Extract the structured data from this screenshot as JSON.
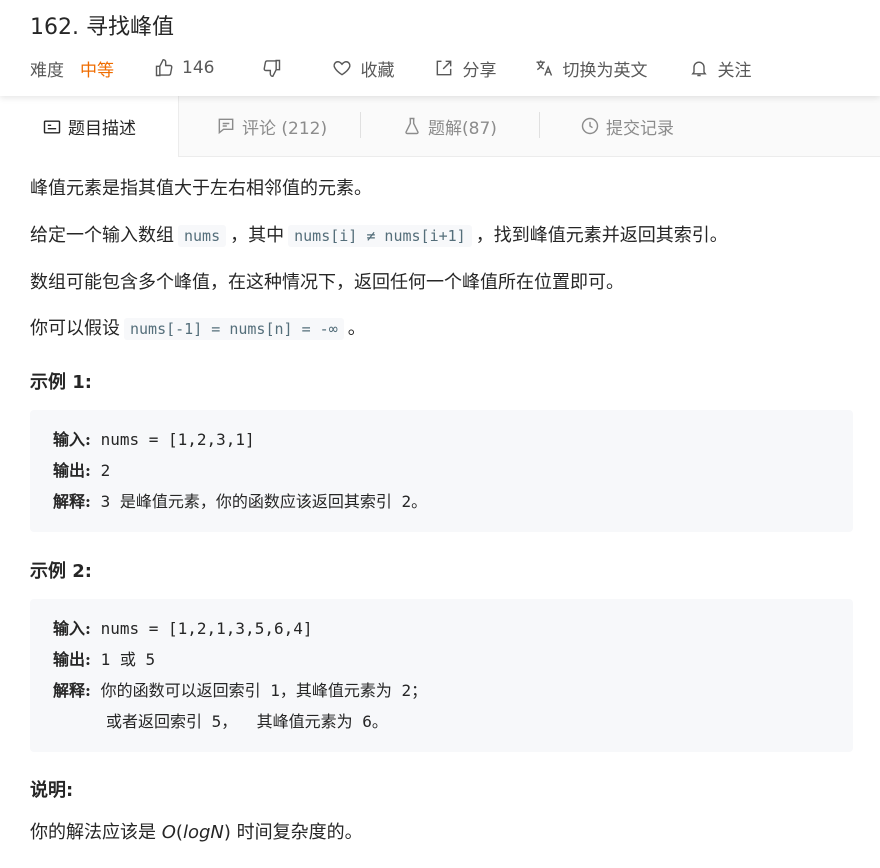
{
  "problem": {
    "title": "162. 寻找峰值",
    "difficulty_label": "难度",
    "difficulty_value": "中等",
    "likes": "146",
    "favorite_label": "收藏",
    "share_label": "分享",
    "switch_lang_label": "切换为英文",
    "follow_label": "关注"
  },
  "tabs": [
    {
      "label": "题目描述"
    },
    {
      "label": "评论 (212)"
    },
    {
      "label": "题解(87)"
    },
    {
      "label": "提交记录"
    }
  ],
  "description": {
    "p1": "峰值元素是指其值大于左右相邻值的元素。",
    "p2_a": "给定一个输入数组",
    "p2_code1": "nums",
    "p2_b": "，其中",
    "p2_code2": "nums[i] ≠ nums[i+1]",
    "p2_c": "，找到峰值元素并返回其索引。",
    "p3": "数组可能包含多个峰值，在这种情况下，返回任何一个峰值所在位置即可。",
    "p4_a": "你可以假设",
    "p4_code": "nums[-1] = nums[n] = -∞",
    "p4_b": "。"
  },
  "example1": {
    "heading": "示例 1:",
    "input_label": "输入:",
    "input_value": "nums = [1,2,3,1]",
    "output_label": "输出:",
    "output_value": "2",
    "explain_label": "解释:",
    "explain_num": "3",
    "explain_text": "是峰值元素，你的函数应该返回其索引",
    "explain_idx": "2。"
  },
  "example2": {
    "heading": "示例 2:",
    "input_label": "输入:",
    "input_value": "nums = [1,2,1,3,5,6,4]",
    "output_label": "输出:",
    "output_a": "1",
    "output_or": "或",
    "output_b": "5",
    "explain_label": "解释:",
    "explain_text1": "你的函数可以返回索引",
    "explain_idx1": "1，",
    "explain_text2": "其峰值元素为",
    "explain_val1": "2；",
    "explain2_text1": "或者返回索引",
    "explain2_idx": "5，",
    "explain2_text2": "其峰值元素为",
    "explain2_val": "6。"
  },
  "note": {
    "heading": "说明:",
    "text_a": "你的解法应该是",
    "o": "O",
    "paren_l": "(",
    "logn": "logN",
    "paren_r": ")",
    "text_b": "时间复杂度的。"
  }
}
